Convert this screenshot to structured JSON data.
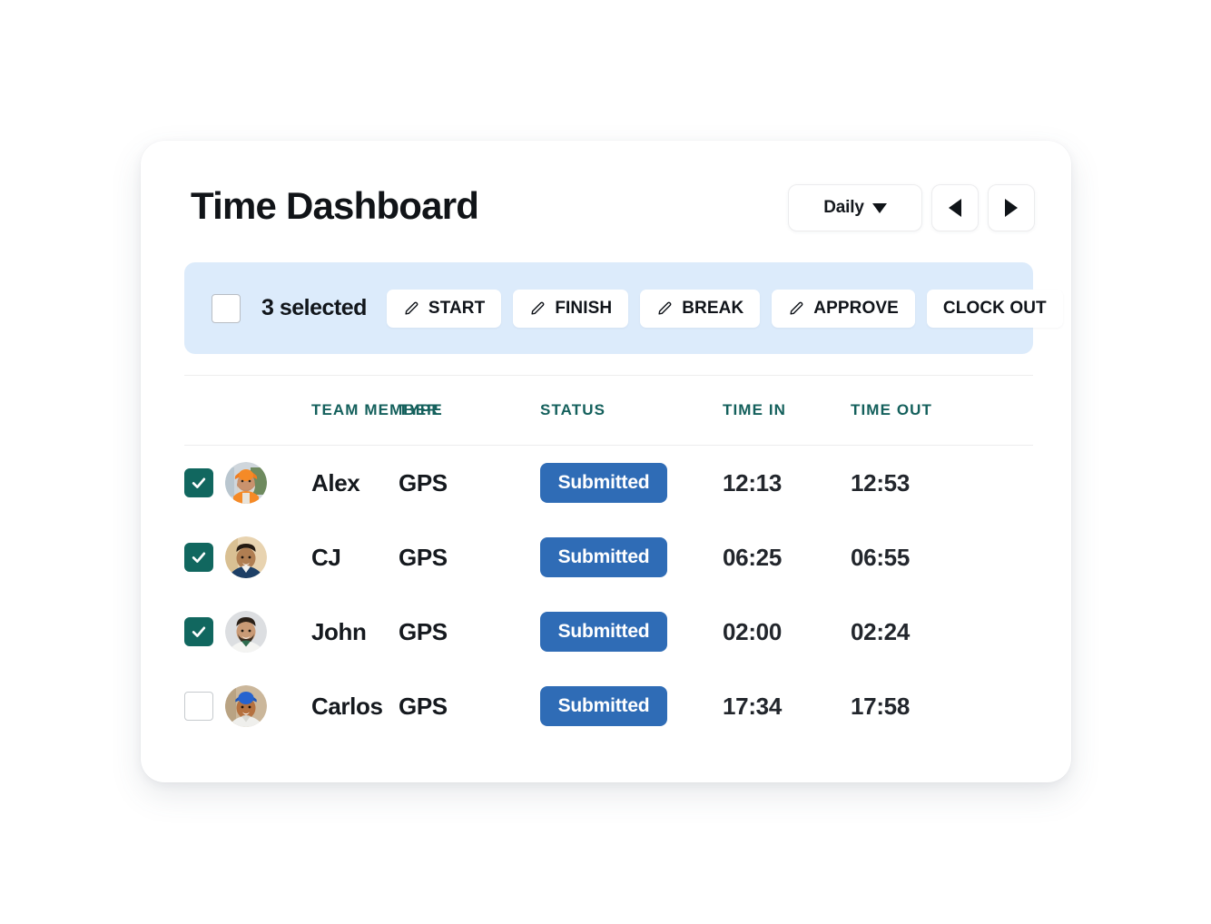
{
  "header": {
    "title": "Time Dashboard",
    "period_label": "Daily",
    "caret_icon": "chevron-down-icon",
    "prev_icon": "triangle-left-icon",
    "next_icon": "triangle-right-icon"
  },
  "selection_bar": {
    "select_all_checked": false,
    "count_label": "3 selected",
    "actions": [
      {
        "label": "START",
        "icon": "pencil-icon",
        "has_icon": true
      },
      {
        "label": "FINISH",
        "icon": "pencil-icon",
        "has_icon": true
      },
      {
        "label": "BREAK",
        "icon": "pencil-icon",
        "has_icon": true
      },
      {
        "label": "APPROVE",
        "icon": "pencil-icon",
        "has_icon": true
      },
      {
        "label": "CLOCK OUT",
        "icon": "",
        "has_icon": false
      }
    ]
  },
  "table": {
    "columns": {
      "team_member": "TEAM MEMBER",
      "type": "TYPE",
      "status": "STATUS",
      "time_in": "TIME IN",
      "time_out": "TIME OUT"
    },
    "rows": [
      {
        "selected": true,
        "avatar": "avatar-alex",
        "name": "Alex",
        "type": "GPS",
        "status": "Submitted",
        "time_in": "12:13",
        "time_out": "12:53"
      },
      {
        "selected": true,
        "avatar": "avatar-cj",
        "name": "CJ",
        "type": "GPS",
        "status": "Submitted",
        "time_in": "06:25",
        "time_out": "06:55"
      },
      {
        "selected": true,
        "avatar": "avatar-john",
        "name": "John",
        "type": "GPS",
        "status": "Submitted",
        "time_in": "02:00",
        "time_out": "02:24"
      },
      {
        "selected": false,
        "avatar": "avatar-carlos",
        "name": "Carlos",
        "type": "GPS",
        "status": "Submitted",
        "time_in": "17:34",
        "time_out": "17:58"
      }
    ]
  },
  "colors": {
    "accent_teal": "#11675f",
    "header_teal": "#14605c",
    "badge_blue": "#2f6cb6",
    "selection_bar_blue": "#dcebfb",
    "text_dark": "#15191e"
  }
}
